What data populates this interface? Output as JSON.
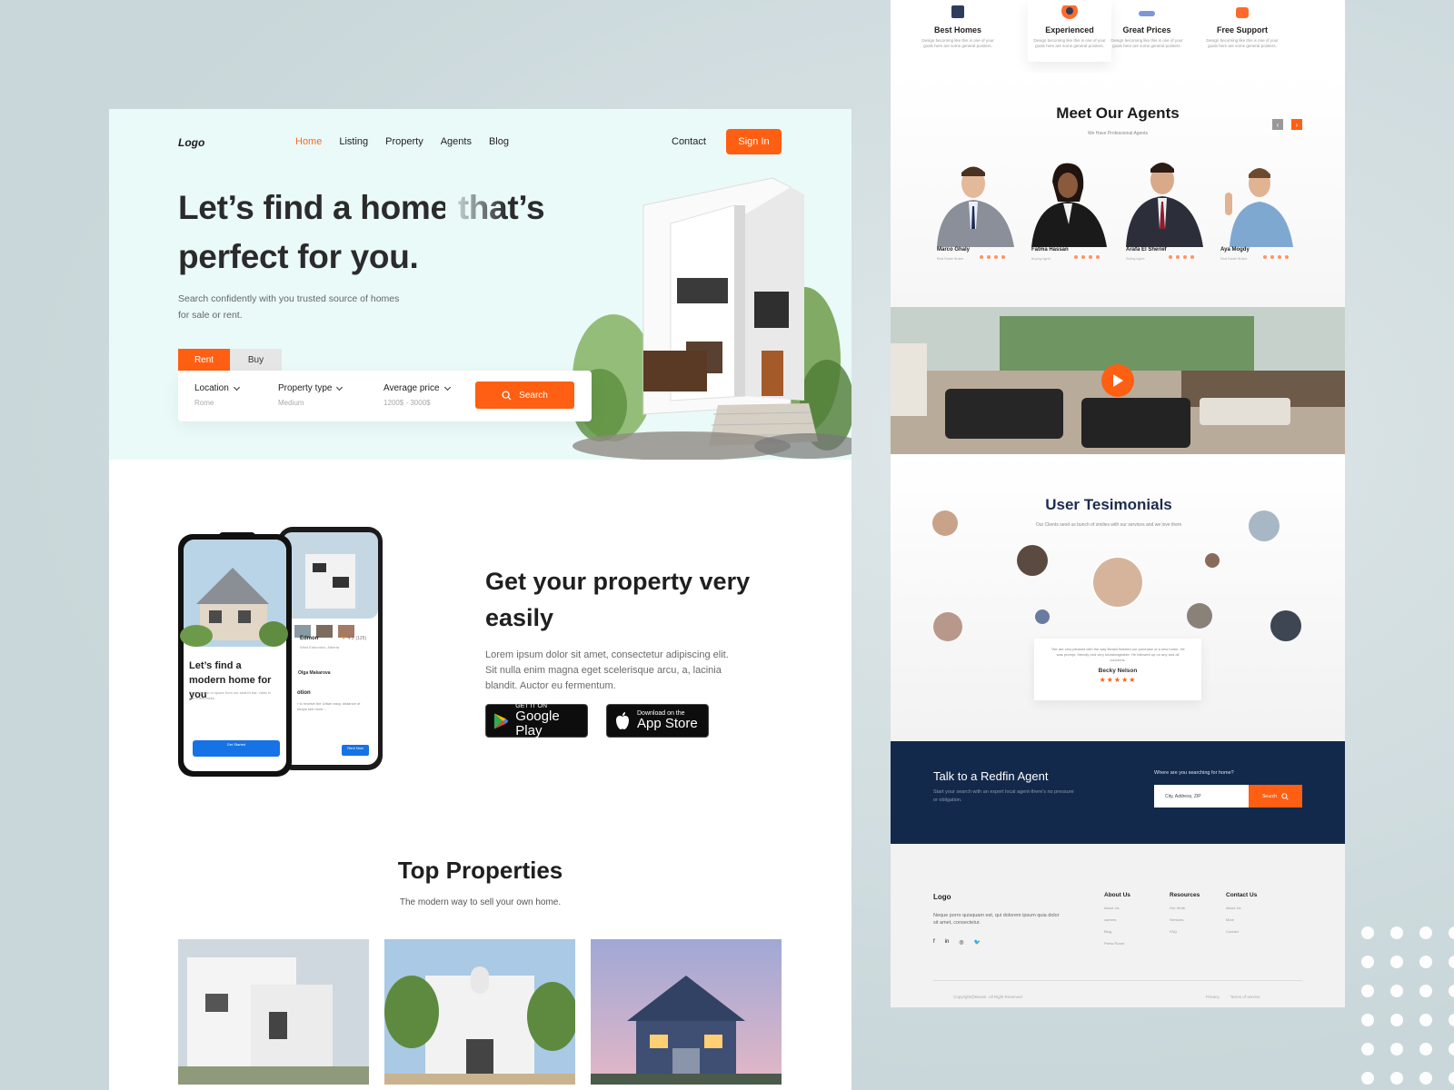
{
  "left_page": {
    "nav": {
      "logo": "Logo",
      "links": [
        "Home",
        "Listing",
        "Property",
        "Agents",
        "Blog"
      ],
      "active": "Home",
      "contact": "Contact",
      "sign_in": "Sign In"
    },
    "hero": {
      "title": "Let’s find a home that’s perfect for you.",
      "subtitle": "Search confidently with you trusted source of homes for sale or rent.",
      "tabs": [
        "Rent",
        "Buy"
      ],
      "active_tab": "Rent",
      "search_fields": [
        {
          "label": "Location",
          "value": "Rome"
        },
        {
          "label": "Property type",
          "value": "Medium"
        },
        {
          "label": "Average price",
          "value": "1200$ - 3000$"
        }
      ],
      "search_button": "Search"
    },
    "app_section": {
      "phone": {
        "headline": "Let’s find a modern home for you",
        "body": "Find a home or space from our search bar. visits in just a few clicks.",
        "cta": "Get Started",
        "listing_name": "Edmon",
        "listing_rating": "4.5",
        "listing_reviews": "(125)",
        "listing_address": "West Edmonton, Alberta",
        "agent_name": "Olga Makarova",
        "section_label": "otion",
        "section_text": "r to receive the Urban easy, distance of shops see more...",
        "rent_button": "Rent Now",
        "badge": "4.5"
      },
      "title": "Get your property very easily",
      "text": "Lorem ipsum dolor sit amet, consectetur adipiscing elit. Sit nulla enim magna eget scelerisque arcu, a, lacinia blandit. Auctor eu fermentum.",
      "google_play": {
        "small": "GET IT ON",
        "big": "Google Play"
      },
      "app_store": {
        "small": "Download on the",
        "big": "App Store"
      }
    },
    "top_properties": {
      "title": "Top Properties",
      "subtitle": "The modern way to sell your own home."
    }
  },
  "right_page": {
    "features": [
      {
        "title": "Best Homes",
        "desc": "Design becoming like this is one of your goals here are some general pointers."
      },
      {
        "title": "Experienced",
        "desc": "Design becoming like this is one of your goals here are some general pointers."
      },
      {
        "title": "Great Prices",
        "desc": "Design becoming like this is one of your goals here are some general pointers."
      },
      {
        "title": "Free Support",
        "desc": "Design becoming like this is one of your goals here are some general pointers."
      }
    ],
    "agents": {
      "title": "Meet Our Agents",
      "subtitle": "We Have Professional Agents",
      "list": [
        {
          "name": "Marco Ghaly",
          "role": "Real Estate Broker"
        },
        {
          "name": "Fatma Hassan",
          "role": "Buying Agent"
        },
        {
          "name": "Arafa El Sherief",
          "role": "Selling Agent"
        },
        {
          "name": "Aya Mogdy",
          "role": "Real Estate Broker"
        }
      ]
    },
    "testimonials": {
      "title": "User Tesimonials",
      "subtitle": "Our Clients send us bunch of smilies with our services and we love them",
      "quote": "\"We are very pleased with the way Beasti finished our purchase of a new home. He was prompt, friendly and very knowledgeable. He followed up on any and all concerns.",
      "author": "Becky Nelson",
      "stars": "★★★★★"
    },
    "cta": {
      "title": "Talk to a Redfin Agent",
      "subtitle": "Start your search with an expert local agent-there's no pressure or obligation.",
      "question": "Where are you searching for home?",
      "placeholder": "City, Address, ZIP",
      "button": "Search"
    },
    "footer": {
      "logo": "Logo",
      "text": "Neque porro quisquam est, qui dolorem ipsum quia dolor sit amet, consectetur.",
      "social": [
        "f",
        "in",
        "◎",
        "🐦"
      ],
      "columns": [
        {
          "heading": "About Us",
          "items": [
            "About Us",
            "careers",
            "Blog",
            "Press Room"
          ]
        },
        {
          "heading": "Resources",
          "items": [
            "Our Work",
            "Services",
            "FAQ"
          ]
        },
        {
          "heading": "Contact Us",
          "items": [
            "About Us",
            "More",
            "Contact"
          ]
        }
      ],
      "copyright": "Copyright@Beasti. All Right Reserved",
      "legal": [
        "Privacy",
        "Terms of service"
      ]
    }
  },
  "colors": {
    "accent": "#ff5f12",
    "navy": "#13294b",
    "hero_bg": "#eafaf9"
  }
}
